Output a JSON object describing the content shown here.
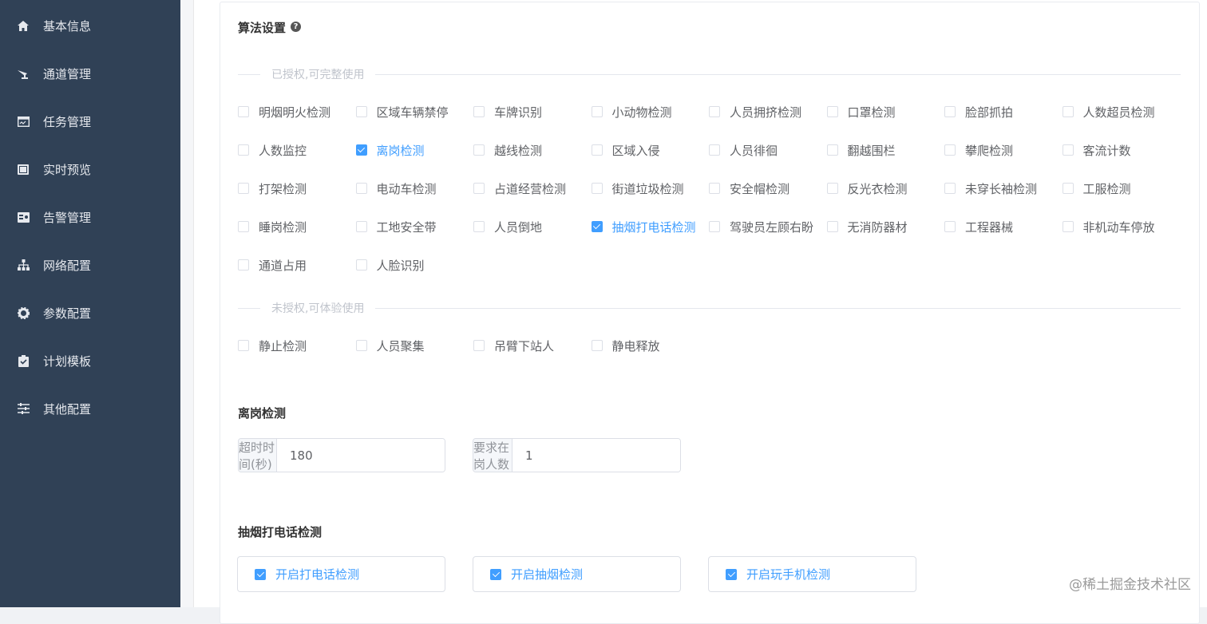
{
  "sidebar": {
    "items": [
      {
        "label": "基本信息",
        "icon": "home-icon"
      },
      {
        "label": "通道管理",
        "icon": "channel-icon"
      },
      {
        "label": "任务管理",
        "icon": "task-icon"
      },
      {
        "label": "实时预览",
        "icon": "preview-icon"
      },
      {
        "label": "告警管理",
        "icon": "alarm-icon"
      },
      {
        "label": "网络配置",
        "icon": "network-icon"
      },
      {
        "label": "参数配置",
        "icon": "gear-icon"
      },
      {
        "label": "计划模板",
        "icon": "clipboard-icon"
      },
      {
        "label": "其他配置",
        "icon": "sliders-icon"
      }
    ]
  },
  "algorithm": {
    "title": "算法设置",
    "help_glyph": "?",
    "licensed_label": "已授权,可完整使用",
    "unlicensed_label": "未授权,可体验使用",
    "licensed": [
      {
        "label": "明烟明火检测",
        "checked": false
      },
      {
        "label": "区域车辆禁停",
        "checked": false
      },
      {
        "label": "车牌识别",
        "checked": false
      },
      {
        "label": "小动物检测",
        "checked": false
      },
      {
        "label": "人员拥挤检测",
        "checked": false
      },
      {
        "label": "口罩检测",
        "checked": false
      },
      {
        "label": "脸部抓拍",
        "checked": false
      },
      {
        "label": "人数超员检测",
        "checked": false
      },
      {
        "label": "人数监控",
        "checked": false
      },
      {
        "label": "离岗检测",
        "checked": true
      },
      {
        "label": "越线检测",
        "checked": false
      },
      {
        "label": "区域入侵",
        "checked": false
      },
      {
        "label": "人员徘徊",
        "checked": false
      },
      {
        "label": "翻越围栏",
        "checked": false
      },
      {
        "label": "攀爬检测",
        "checked": false
      },
      {
        "label": "客流计数",
        "checked": false
      },
      {
        "label": "打架检测",
        "checked": false
      },
      {
        "label": "电动车检测",
        "checked": false
      },
      {
        "label": "占道经营检测",
        "checked": false
      },
      {
        "label": "街道垃圾检测",
        "checked": false
      },
      {
        "label": "安全帽检测",
        "checked": false
      },
      {
        "label": "反光衣检测",
        "checked": false
      },
      {
        "label": "未穿长袖检测",
        "checked": false
      },
      {
        "label": "工服检测",
        "checked": false
      },
      {
        "label": "睡岗检测",
        "checked": false
      },
      {
        "label": "工地安全带",
        "checked": false
      },
      {
        "label": "人员倒地",
        "checked": false
      },
      {
        "label": "抽烟打电话检测",
        "checked": true
      },
      {
        "label": "驾驶员左顾右盼",
        "checked": false
      },
      {
        "label": "无消防器材",
        "checked": false
      },
      {
        "label": "工程器械",
        "checked": false
      },
      {
        "label": "非机动车停放",
        "checked": false
      },
      {
        "label": "通道占用",
        "checked": false
      },
      {
        "label": "人脸识别",
        "checked": false
      }
    ],
    "unlicensed": [
      {
        "label": "静止检测",
        "checked": false
      },
      {
        "label": "人员聚集",
        "checked": false
      },
      {
        "label": "吊臂下站人",
        "checked": false
      },
      {
        "label": "静电释放",
        "checked": false
      }
    ]
  },
  "absence": {
    "title": "离岗检测",
    "timeout_label": "超时时间(秒)",
    "timeout_value": "180",
    "required_label": "要求在岗人数",
    "required_value": "1"
  },
  "smoking": {
    "title": "抽烟打电话检测",
    "options": [
      {
        "label": "开启打电话检测",
        "checked": true
      },
      {
        "label": "开启抽烟检测",
        "checked": true
      },
      {
        "label": "开启玩手机检测",
        "checked": true
      }
    ]
  },
  "watermark": "@稀土掘金技术社区",
  "colors": {
    "sidebar": "#304156",
    "accent": "#409eff"
  }
}
